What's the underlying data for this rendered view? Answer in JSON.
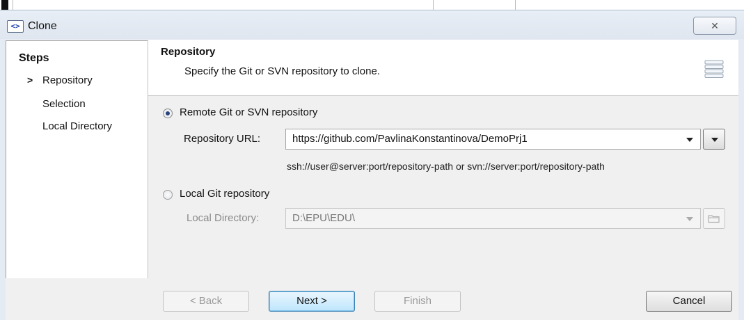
{
  "window": {
    "title": "Clone",
    "app_icon_text": "<>",
    "close_glyph": "✕"
  },
  "steps": {
    "title": "Steps",
    "current_marker": ">",
    "items": [
      {
        "label": "Repository",
        "current": true
      },
      {
        "label": "Selection",
        "current": false
      },
      {
        "label": "Local Directory",
        "current": false
      }
    ]
  },
  "header": {
    "title": "Repository",
    "description": "Specify the Git or SVN repository to clone.",
    "icon": "repository-stack-icon"
  },
  "remote": {
    "option_label": "Remote Git or SVN repository",
    "selected": true,
    "url_label": "Repository URL:",
    "url_value": "https://github.com/PavlinaKonstantinova/DemoPrj1",
    "hint": "ssh://user@server:port/repository-path or svn://server:port/repository-path"
  },
  "local": {
    "option_label": "Local Git repository",
    "selected": false,
    "dir_label": "Local Directory:",
    "dir_value": "D:\\EPU\\EDU\\",
    "enabled": false
  },
  "buttons": {
    "back": "< Back",
    "next": "Next >",
    "finish": "Finish",
    "cancel": "Cancel"
  }
}
